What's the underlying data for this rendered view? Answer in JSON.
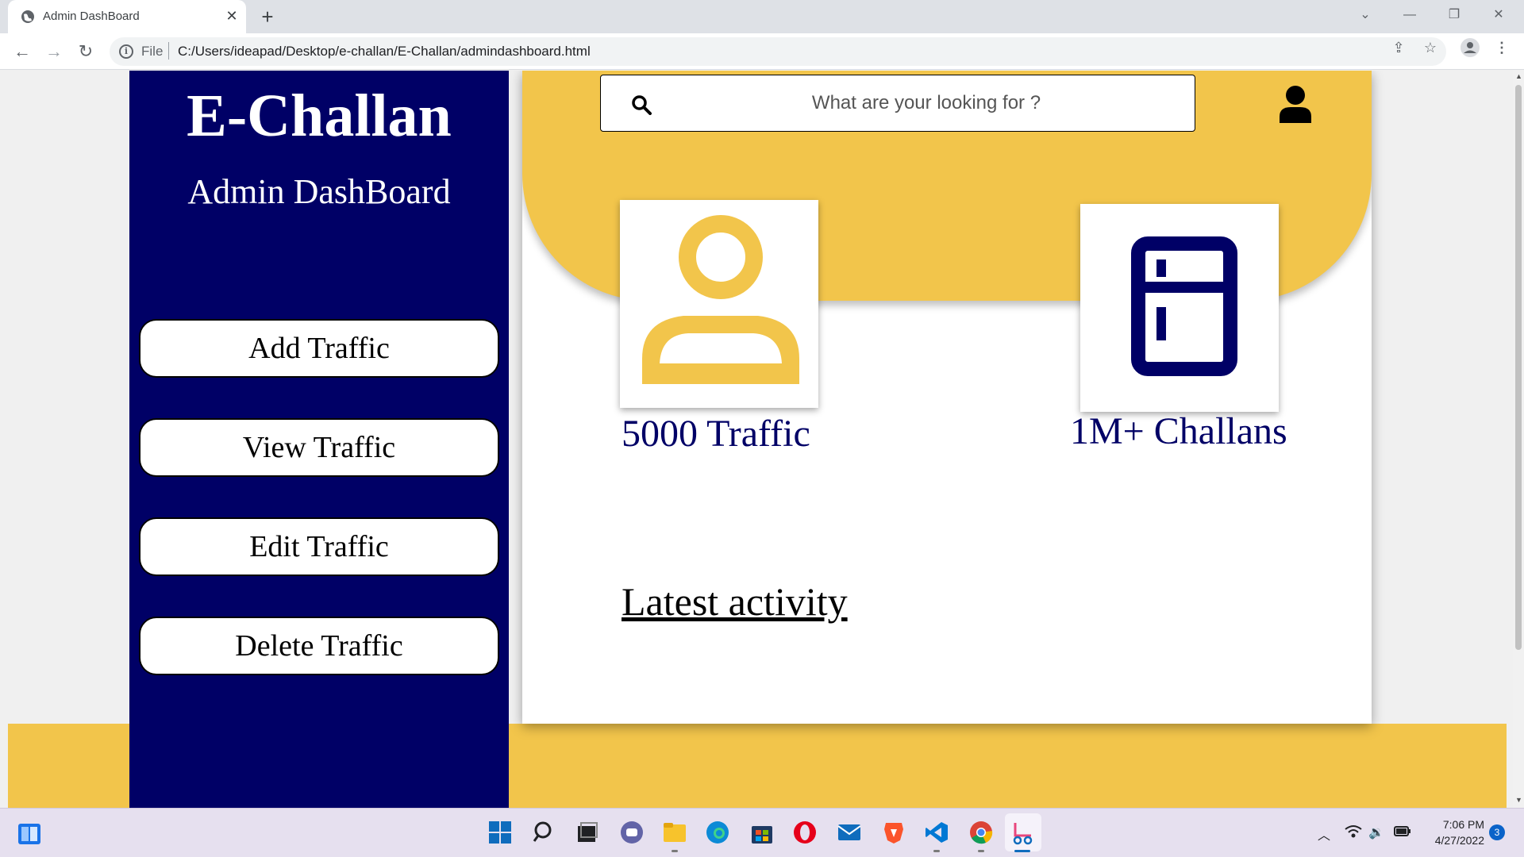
{
  "browser": {
    "tab_title": "Admin DashBoard",
    "tab_close": "✕",
    "new_tab": "+",
    "scheme": "File",
    "url": "C:/Users/ideapad/Desktop/e-challan/E-Challan/admindashboard.html",
    "window": {
      "dropdown": "⌄",
      "minimize": "—",
      "restore": "❐",
      "close": "✕"
    }
  },
  "sidebar": {
    "brand": "E-Challan",
    "subtitle": "Admin DashBoard",
    "buttons": [
      {
        "label": "Add Traffic"
      },
      {
        "label": "View Traffic"
      },
      {
        "label": "Edit Traffic"
      },
      {
        "label": "Delete Traffic"
      }
    ]
  },
  "search": {
    "placeholder": "What are your looking for ?"
  },
  "stats": [
    {
      "label": "5000 Traffic",
      "icon": "person-icon",
      "color": "#f2c54b"
    },
    {
      "label": "1M+ Challans",
      "icon": "fridge-icon",
      "color": "#000066"
    }
  ],
  "latest_activity": "Latest activity",
  "colors": {
    "navy": "#000066",
    "yellow": "#f2c54b"
  },
  "taskbar": {
    "time": "7:06 PM",
    "date": "4/27/2022",
    "notifications": "3"
  }
}
